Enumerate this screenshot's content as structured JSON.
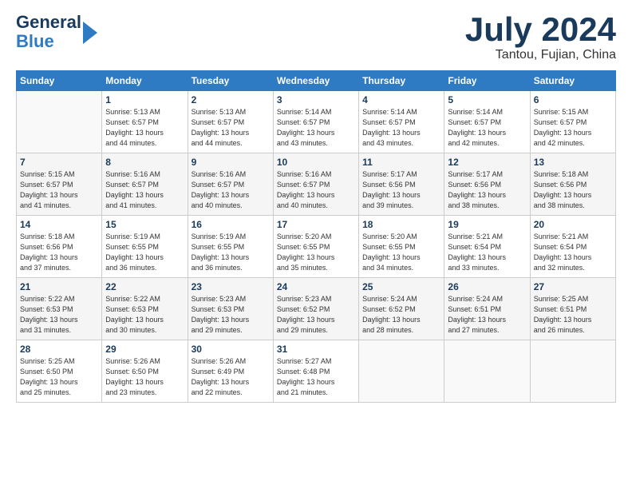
{
  "header": {
    "logo_line1": "General",
    "logo_line2": "Blue",
    "month": "July 2024",
    "location": "Tantou, Fujian, China"
  },
  "weekdays": [
    "Sunday",
    "Monday",
    "Tuesday",
    "Wednesday",
    "Thursday",
    "Friday",
    "Saturday"
  ],
  "weeks": [
    [
      {
        "day": "",
        "info": ""
      },
      {
        "day": "1",
        "info": "Sunrise: 5:13 AM\nSunset: 6:57 PM\nDaylight: 13 hours\nand 44 minutes."
      },
      {
        "day": "2",
        "info": "Sunrise: 5:13 AM\nSunset: 6:57 PM\nDaylight: 13 hours\nand 44 minutes."
      },
      {
        "day": "3",
        "info": "Sunrise: 5:14 AM\nSunset: 6:57 PM\nDaylight: 13 hours\nand 43 minutes."
      },
      {
        "day": "4",
        "info": "Sunrise: 5:14 AM\nSunset: 6:57 PM\nDaylight: 13 hours\nand 43 minutes."
      },
      {
        "day": "5",
        "info": "Sunrise: 5:14 AM\nSunset: 6:57 PM\nDaylight: 13 hours\nand 42 minutes."
      },
      {
        "day": "6",
        "info": "Sunrise: 5:15 AM\nSunset: 6:57 PM\nDaylight: 13 hours\nand 42 minutes."
      }
    ],
    [
      {
        "day": "7",
        "info": "Sunrise: 5:15 AM\nSunset: 6:57 PM\nDaylight: 13 hours\nand 41 minutes."
      },
      {
        "day": "8",
        "info": "Sunrise: 5:16 AM\nSunset: 6:57 PM\nDaylight: 13 hours\nand 41 minutes."
      },
      {
        "day": "9",
        "info": "Sunrise: 5:16 AM\nSunset: 6:57 PM\nDaylight: 13 hours\nand 40 minutes."
      },
      {
        "day": "10",
        "info": "Sunrise: 5:16 AM\nSunset: 6:57 PM\nDaylight: 13 hours\nand 40 minutes."
      },
      {
        "day": "11",
        "info": "Sunrise: 5:17 AM\nSunset: 6:56 PM\nDaylight: 13 hours\nand 39 minutes."
      },
      {
        "day": "12",
        "info": "Sunrise: 5:17 AM\nSunset: 6:56 PM\nDaylight: 13 hours\nand 38 minutes."
      },
      {
        "day": "13",
        "info": "Sunrise: 5:18 AM\nSunset: 6:56 PM\nDaylight: 13 hours\nand 38 minutes."
      }
    ],
    [
      {
        "day": "14",
        "info": "Sunrise: 5:18 AM\nSunset: 6:56 PM\nDaylight: 13 hours\nand 37 minutes."
      },
      {
        "day": "15",
        "info": "Sunrise: 5:19 AM\nSunset: 6:55 PM\nDaylight: 13 hours\nand 36 minutes."
      },
      {
        "day": "16",
        "info": "Sunrise: 5:19 AM\nSunset: 6:55 PM\nDaylight: 13 hours\nand 36 minutes."
      },
      {
        "day": "17",
        "info": "Sunrise: 5:20 AM\nSunset: 6:55 PM\nDaylight: 13 hours\nand 35 minutes."
      },
      {
        "day": "18",
        "info": "Sunrise: 5:20 AM\nSunset: 6:55 PM\nDaylight: 13 hours\nand 34 minutes."
      },
      {
        "day": "19",
        "info": "Sunrise: 5:21 AM\nSunset: 6:54 PM\nDaylight: 13 hours\nand 33 minutes."
      },
      {
        "day": "20",
        "info": "Sunrise: 5:21 AM\nSunset: 6:54 PM\nDaylight: 13 hours\nand 32 minutes."
      }
    ],
    [
      {
        "day": "21",
        "info": "Sunrise: 5:22 AM\nSunset: 6:53 PM\nDaylight: 13 hours\nand 31 minutes."
      },
      {
        "day": "22",
        "info": "Sunrise: 5:22 AM\nSunset: 6:53 PM\nDaylight: 13 hours\nand 30 minutes."
      },
      {
        "day": "23",
        "info": "Sunrise: 5:23 AM\nSunset: 6:53 PM\nDaylight: 13 hours\nand 29 minutes."
      },
      {
        "day": "24",
        "info": "Sunrise: 5:23 AM\nSunset: 6:52 PM\nDaylight: 13 hours\nand 29 minutes."
      },
      {
        "day": "25",
        "info": "Sunrise: 5:24 AM\nSunset: 6:52 PM\nDaylight: 13 hours\nand 28 minutes."
      },
      {
        "day": "26",
        "info": "Sunrise: 5:24 AM\nSunset: 6:51 PM\nDaylight: 13 hours\nand 27 minutes."
      },
      {
        "day": "27",
        "info": "Sunrise: 5:25 AM\nSunset: 6:51 PM\nDaylight: 13 hours\nand 26 minutes."
      }
    ],
    [
      {
        "day": "28",
        "info": "Sunrise: 5:25 AM\nSunset: 6:50 PM\nDaylight: 13 hours\nand 25 minutes."
      },
      {
        "day": "29",
        "info": "Sunrise: 5:26 AM\nSunset: 6:50 PM\nDaylight: 13 hours\nand 23 minutes."
      },
      {
        "day": "30",
        "info": "Sunrise: 5:26 AM\nSunset: 6:49 PM\nDaylight: 13 hours\nand 22 minutes."
      },
      {
        "day": "31",
        "info": "Sunrise: 5:27 AM\nSunset: 6:48 PM\nDaylight: 13 hours\nand 21 minutes."
      },
      {
        "day": "",
        "info": ""
      },
      {
        "day": "",
        "info": ""
      },
      {
        "day": "",
        "info": ""
      }
    ]
  ]
}
